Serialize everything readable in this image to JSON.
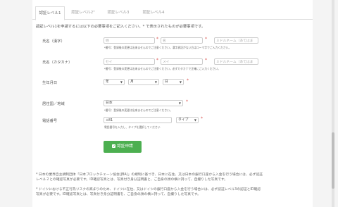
{
  "tabs": [
    {
      "label": "認証レベル1"
    },
    {
      "label": "認証レベル2\""
    },
    {
      "label": "認証レベル3"
    },
    {
      "label": "認証レベル4"
    }
  ],
  "intro": "認証レベル1を申請するには以下の必要事項をご記入ください。* で表示されたものが必要事項です。",
  "fields": {
    "kanji": {
      "label": "氏名（漢字）",
      "sei_placeholder": "姓",
      "mei_placeholder": "名",
      "middle_placeholder": "ミドルネーム（あてはま",
      "hint": "*番号：登録後の変更は出来ませんのでご注意ください。漢字表記がない方はローマ字でご入力ください。"
    },
    "kana": {
      "label": "氏名（カタカナ）",
      "sei_placeholder": "セイ",
      "mei_placeholder": "メイ",
      "middle_placeholder": "ミドルネーム（あてはま",
      "hint": "*番号：登録後の変更は出来ませんのでご注意ください。必ずカタカナで正確にご入力ください。"
    },
    "birth": {
      "label": "生年月日",
      "year": "年",
      "month": "月",
      "day": "日"
    },
    "country": {
      "label": "居住国／地域",
      "value": "日本",
      "hint": "*番号：登録後の変更は出来ませんのでご注意ください。"
    },
    "phone": {
      "label": "電話番号",
      "value": "+81",
      "type": "タイプ",
      "hint": "電話番号を入力し、タイプを選択してください"
    }
  },
  "submit_label": "認証申請",
  "notes": {
    "note1_line1": "* 日本の業界自主規制団体「日本ブロックチェーン協会(JBA)」の規制に基づき、日本に在住、又は日本の銀行口座から入金を行う場合には、必ず認証",
    "note1_line2": "レベル２との確認写真が必要です。ID確認写真とは、写真付き身分証明書と、ご自身の顔の横に持って、自撮りした写真です。",
    "note2_line1": "* ドイツにおける不正行為リスクの高まりのため、ドイツに在住、又はドイツの銀行口座から入金を行う場合には、必ず認証レベル3の認証とID確認",
    "note2_line2": "写真が必要です。ID確認写真とは、写真付き身分証明書を、ご自身の顔の横に持って、自撮りした写真です。"
  },
  "colors": {
    "accent": "#4caf50",
    "required": "#d9534f"
  }
}
